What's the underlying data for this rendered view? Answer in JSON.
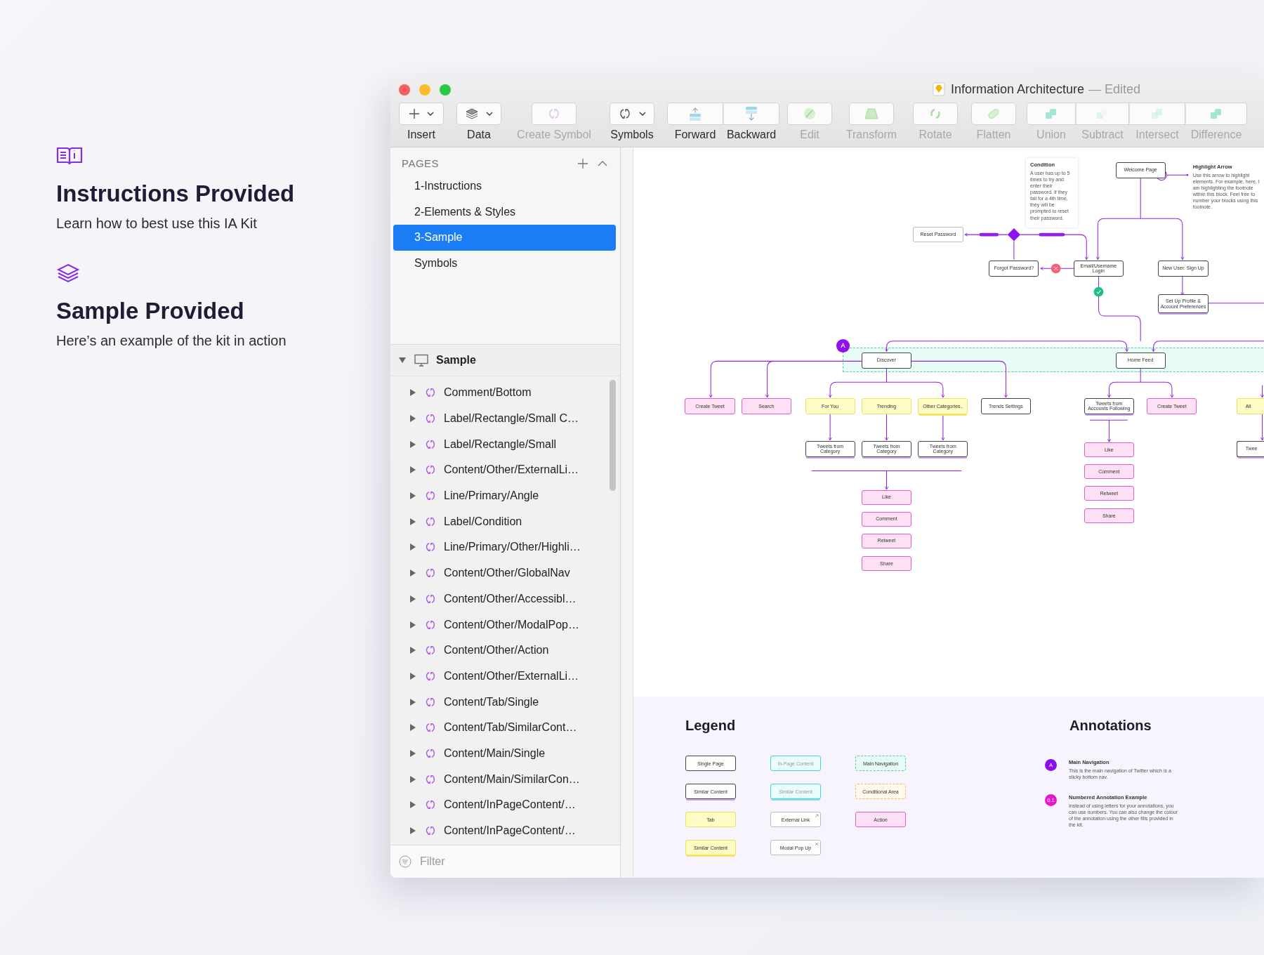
{
  "window": {
    "title": "Information Architecture",
    "status": "— Edited"
  },
  "intro": [
    {
      "heading": "Instructions Provided",
      "text": "Learn how to best use this IA Kit"
    },
    {
      "heading": "Sample Provided",
      "text": "Here’s an example of the kit in action"
    }
  ],
  "toolbar": {
    "tools": [
      {
        "label": "Insert",
        "disabled": false,
        "dropdown": true
      },
      {
        "label": "Data",
        "disabled": false,
        "dropdown": true
      },
      {
        "label": "Create Symbol",
        "disabled": true,
        "dropdown": false
      },
      {
        "label": "Symbols",
        "disabled": false,
        "dropdown": true
      },
      {
        "label": "Forward",
        "disabled": false,
        "dropdown": false
      },
      {
        "label": "Backward",
        "disabled": false,
        "dropdown": false
      },
      {
        "label": "Edit",
        "disabled": true,
        "dropdown": false
      },
      {
        "label": "Transform",
        "disabled": true,
        "dropdown": false
      },
      {
        "label": "Rotate",
        "disabled": true,
        "dropdown": false
      },
      {
        "label": "Flatten",
        "disabled": true,
        "dropdown": false
      },
      {
        "label": "Union",
        "disabled": true,
        "dropdown": false
      },
      {
        "label": "Subtract",
        "disabled": true,
        "dropdown": false
      },
      {
        "label": "Intersect",
        "disabled": true,
        "dropdown": false
      },
      {
        "label": "Difference",
        "disabled": true,
        "dropdown": false
      }
    ]
  },
  "pages": {
    "header": "PAGES",
    "items": [
      {
        "label": "1-Instructions",
        "selected": false
      },
      {
        "label": "2-Elements & Styles",
        "selected": false
      },
      {
        "label": "3-Sample",
        "selected": true
      },
      {
        "label": "Symbols",
        "selected": false
      }
    ]
  },
  "layers": {
    "group": {
      "label": "Sample",
      "expanded": true
    },
    "items": [
      {
        "label": "Comment/Bottom",
        "expanded": false
      },
      {
        "label": "Label/Rectangle/Small C…",
        "expanded": false
      },
      {
        "label": "Label/Rectangle/Small",
        "expanded": false
      },
      {
        "label": "Content/Other/ExternalLi…",
        "expanded": false
      },
      {
        "label": "Line/Primary/Angle",
        "expanded": false
      },
      {
        "label": "Label/Condition",
        "expanded": false
      },
      {
        "label": "Line/Primary/Other/Highli…",
        "expanded": false
      },
      {
        "label": "Content/Other/GlobalNav",
        "expanded": false
      },
      {
        "label": "Content/Other/Accessibl…",
        "expanded": false
      },
      {
        "label": "Content/Other/ModalPop…",
        "expanded": false
      },
      {
        "label": "Content/Other/Action",
        "expanded": false
      },
      {
        "label": "Content/Other/ExternalLi…",
        "expanded": false
      },
      {
        "label": "Content/Tab/Single",
        "expanded": false
      },
      {
        "label": "Content/Tab/SimilarCont…",
        "expanded": false
      },
      {
        "label": "Content/Main/Single",
        "expanded": false
      },
      {
        "label": "Content/Main/SimilarCon…",
        "expanded": false
      },
      {
        "label": "Content/InPageContent/…",
        "expanded": false
      },
      {
        "label": "Content/InPageContent/…",
        "expanded": false
      }
    ]
  },
  "filter": {
    "placeholder": "Filter"
  },
  "canvas": {
    "nodes": [
      {
        "label": "Welcome Page",
        "kind": "page"
      },
      {
        "label": "Reset Password",
        "kind": "external"
      },
      {
        "label": "Forgot Password?",
        "kind": "page"
      },
      {
        "label": "Email/Username Login",
        "kind": "page"
      },
      {
        "label": "New User: Sign Up",
        "kind": "page"
      },
      {
        "label": "Set Up Profile & Account Preferences",
        "kind": "pagestack"
      },
      {
        "label": "Discover",
        "kind": "page"
      },
      {
        "label": "Home Feed",
        "kind": "page"
      },
      {
        "label": "Create Tweet",
        "kind": "action"
      },
      {
        "label": "Search",
        "kind": "action"
      },
      {
        "label": "For You",
        "kind": "tab"
      },
      {
        "label": "Trending",
        "kind": "tab"
      },
      {
        "label": "Other Categories..",
        "kind": "tabstack"
      },
      {
        "label": "Trends Settings",
        "kind": "page"
      },
      {
        "label": "Tweets from Accounts Following",
        "kind": "pagestack"
      },
      {
        "label": "Create Tweet",
        "kind": "action"
      },
      {
        "label": "All",
        "kind": "tab"
      },
      {
        "label": "Tweets from Category",
        "kind": "pagestack"
      },
      {
        "label": "Tweets from Category",
        "kind": "pagestack"
      },
      {
        "label": "Tweets from Category",
        "kind": "pagestack"
      },
      {
        "label": "Twee",
        "kind": "pagestack"
      },
      {
        "label": "Like",
        "kind": "action"
      },
      {
        "label": "Comment",
        "kind": "action"
      },
      {
        "label": "Retweet",
        "kind": "action"
      },
      {
        "label": "Share",
        "kind": "action"
      },
      {
        "label": "Like",
        "kind": "action"
      },
      {
        "label": "Comment",
        "kind": "action"
      },
      {
        "label": "Retweet",
        "kind": "action"
      },
      {
        "label": "Share",
        "kind": "action"
      }
    ],
    "highlight": {
      "title": "Highlight Arrow",
      "text": "Use this arrow to highlight elements. For example, here, I am highlighting the footnote within this block. Feel free to number your blocks using this footnote."
    },
    "condition": {
      "title": "Condition",
      "text": "A user has up to 5 times to try and enter their password. If they fail for a 4th time, they will be prompted to reset their password."
    },
    "nav_marker": "A"
  },
  "legend": {
    "title": "Legend",
    "items": [
      {
        "label": "Single Page",
        "kind": "page"
      },
      {
        "label": "Similar Content",
        "kind": "pagestack"
      },
      {
        "label": "Tab",
        "kind": "tab"
      },
      {
        "label": "Similar Content",
        "kind": "tabstack"
      },
      {
        "label": "In-Page Content",
        "kind": "inpage"
      },
      {
        "label": "Similar Content",
        "kind": "inpagestack"
      },
      {
        "label": "External Link",
        "kind": "external"
      },
      {
        "label": "Modal Pop Up",
        "kind": "modal"
      },
      {
        "label": "Main Navigation",
        "kind": "mainnav"
      },
      {
        "label": "Conditional Area",
        "kind": "conditional"
      },
      {
        "label": "Action",
        "kind": "action"
      }
    ]
  },
  "annotations": {
    "title": "Annotations",
    "items": [
      {
        "marker": "A",
        "title": "Main Navigation",
        "text": "This is the main navigation of Twitter which is a sticky bottom nav.",
        "color": "#8c0ff0"
      },
      {
        "marker": "0.1",
        "title": "Numbered Annotation Example",
        "text": "Instead of using letters for your annotations, you can use numbers. You can also change the colour of the annotation using the other fills provided in the kit.",
        "color": "#e619c8"
      }
    ]
  }
}
